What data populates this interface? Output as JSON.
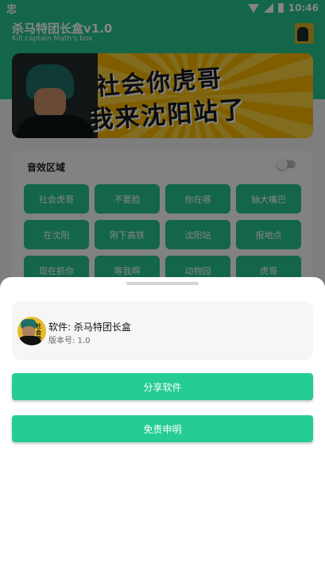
{
  "status_bar": {
    "left_icon": "android-debug-icon",
    "left_glyph": "忠",
    "time": "10:46"
  },
  "header": {
    "title": "杀马特团长盒v1.0",
    "subtitle": "Kill captain Math's box"
  },
  "banner": {
    "line1": "社会你虎哥",
    "line2": "我来沈阳站了"
  },
  "sound_section": {
    "title": "音效区域",
    "toggle_on": false,
    "buttons": [
      "社会虎哥",
      "不要脸",
      "你在哪",
      "抽大嘴巴",
      "在沈阳",
      "刚下高铁",
      "沈阳站",
      "报地点",
      "现在抓你",
      "等我啊",
      "动物园",
      "虎哥"
    ]
  },
  "sheet": {
    "app_icon_text": "社会\n我来",
    "app_name": "软件: 杀马特团长盒",
    "version": "版本号: 1.0",
    "share_label": "分享软件",
    "disclaimer_label": "免责申明"
  },
  "colors": {
    "accent": "#25c48d",
    "button": "#25cc94",
    "scrim": "rgba(0,0,0,0.48)"
  }
}
